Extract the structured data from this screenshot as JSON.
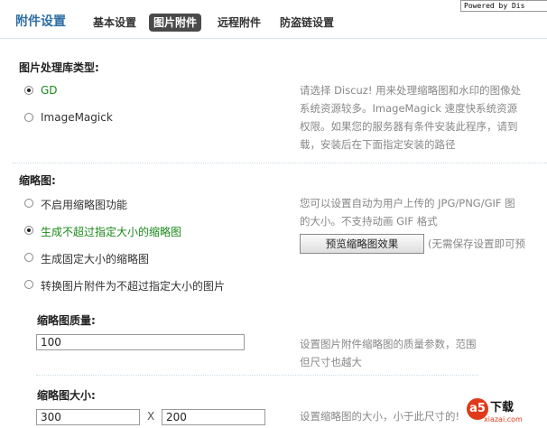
{
  "watermark": "Powered by Dis",
  "header": {
    "title": "附件设置",
    "tabs": [
      {
        "label": "基本设置"
      },
      {
        "label": "图片附件"
      },
      {
        "label": "远程附件"
      },
      {
        "label": "防盗链设置"
      }
    ],
    "active_tab": "图片附件"
  },
  "image_lib": {
    "title": "图片处理库类型:",
    "options": [
      {
        "label": "GD",
        "selected": true
      },
      {
        "label": "ImageMagick",
        "selected": false
      }
    ],
    "desc": [
      "请选择 Discuz! 用来处理缩略图和水印的图像处",
      "系统资源较多。ImageMagick 速度快系统资源",
      "权限。如果您的服务器有条件安装此程序，请到",
      "载，安装后在下面指定安装的路径"
    ]
  },
  "thumbnail": {
    "title": "缩略图:",
    "options": [
      {
        "label": "不启用缩略图功能",
        "selected": false
      },
      {
        "label": "生成不超过指定大小的缩略图",
        "selected": true
      },
      {
        "label": "生成固定大小的缩略图",
        "selected": false
      },
      {
        "label": "转换图片附件为不超过指定大小的图片",
        "selected": false
      }
    ],
    "desc": [
      "您可以设置自动为用户上传的 JPG/PNG/GIF 图",
      "的大小。不支持动画 GIF 格式"
    ],
    "preview_button": "预览缩略图效果",
    "preview_note": "(无需保存设置即可预"
  },
  "quality": {
    "title": "缩略图质量:",
    "value": "100",
    "desc": [
      "设置图片附件缩略图的质量参数，范围",
      "但尺寸也越大"
    ]
  },
  "size": {
    "title": "缩略图大小:",
    "width": "300",
    "separator": "X",
    "height": "200",
    "desc": "设置缩略图的大小，小于此尺寸的!"
  },
  "logo": {
    "mark": "a5",
    "text": "下载",
    "sub": "xiazai.com"
  },
  "colors": {
    "header_title": "#2f6fa6",
    "active_tab_bg": "#4a4a4a",
    "selected_option": "#1a8a1a",
    "desc_text": "#888888"
  }
}
